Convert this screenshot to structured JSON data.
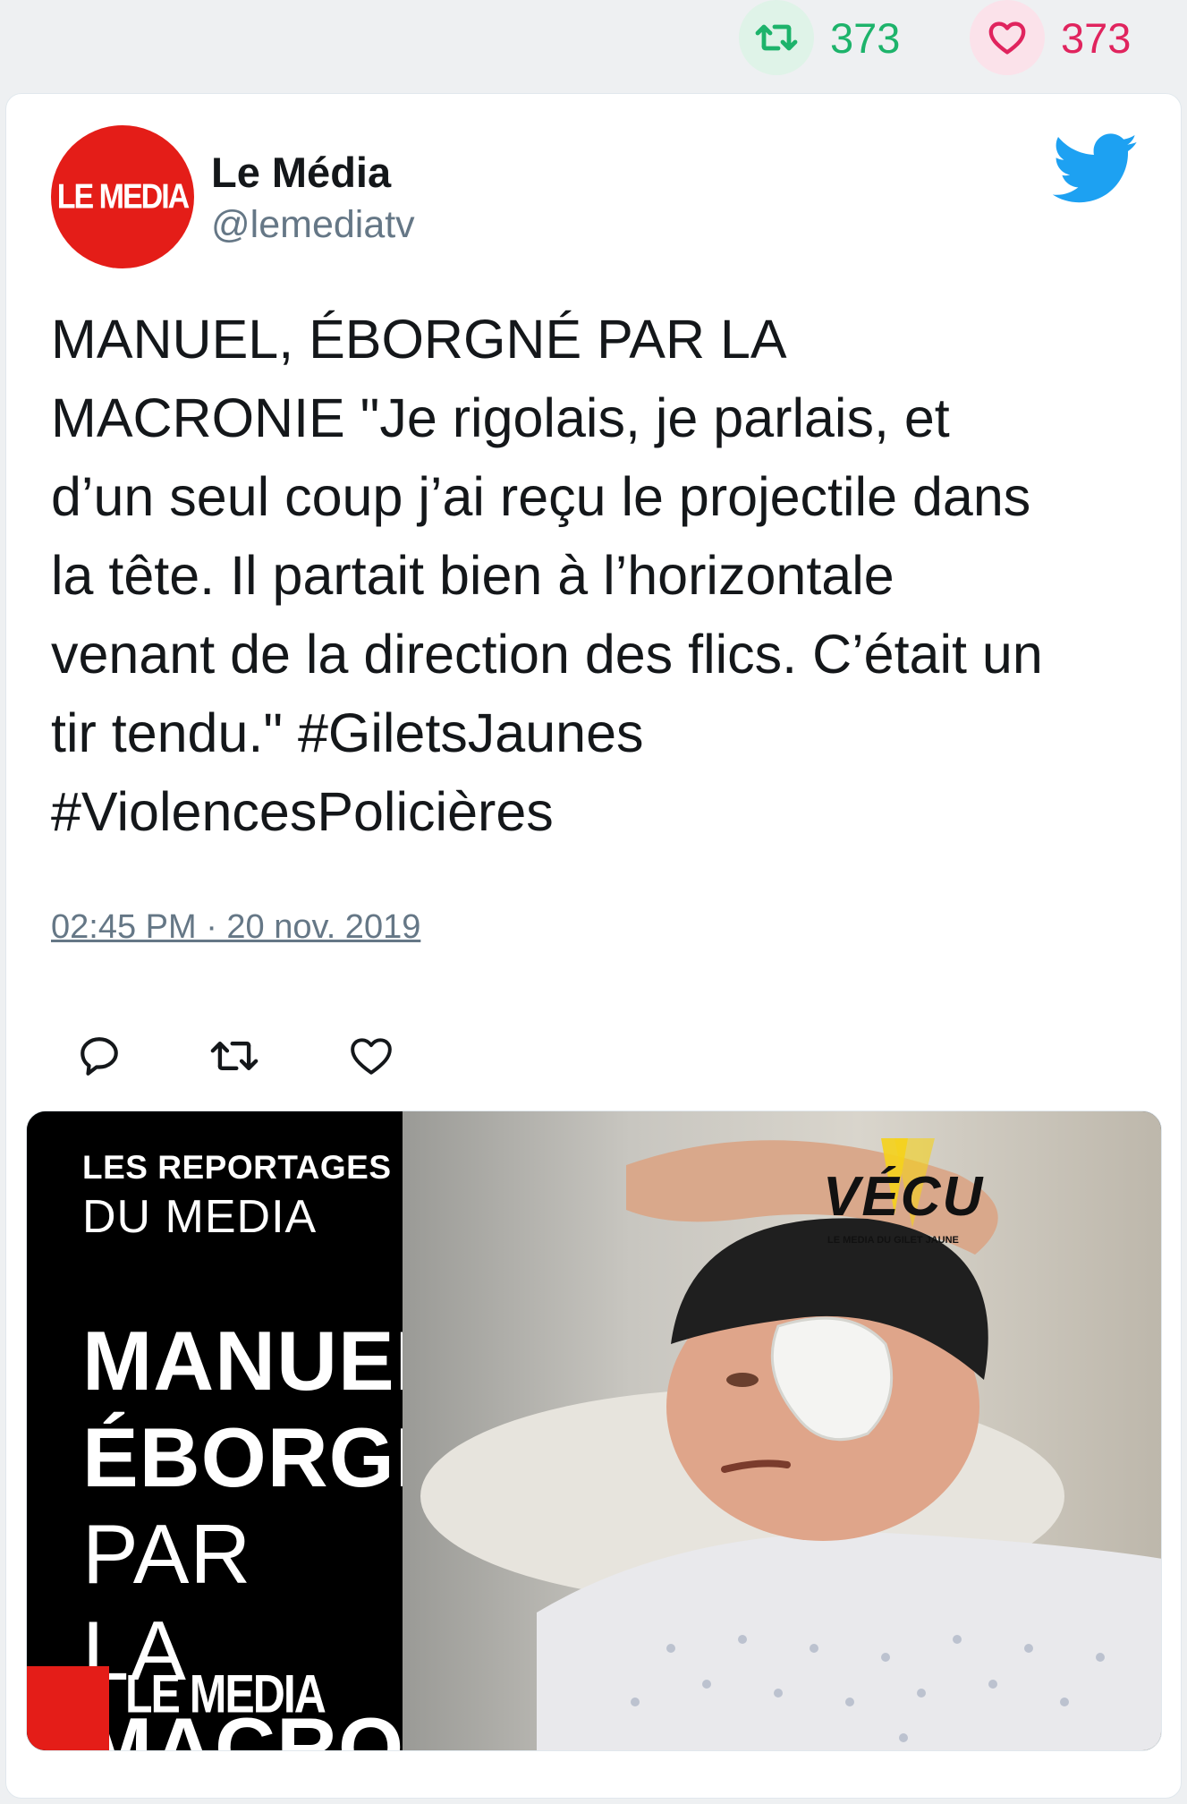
{
  "top_stats": {
    "retweet_count": "373",
    "like_count": "373"
  },
  "tweet": {
    "author_name": "Le Média",
    "author_handle": "@lemediatv",
    "avatar_logo_text": "LE MEDIA",
    "text": "MANUEL, ÉBORGNÉ PAR LA\nMACRONIE \"Je rigolais, je parlais, et\nd’un seul coup j’ai reçu le projectile dans\nla tête. Il partait bien à l’horizontale\nvenant de la direction des flics. C’était un\ntir tendu.\" #GiletsJaunes\n#ViolencesPolicières",
    "timestamp": "02:45 PM · 20 nov. 2019"
  },
  "media": {
    "series_line1": "LES REPORTAGES",
    "series_line2": "DU MEDIA",
    "headline_bold1": "MANUEL,",
    "headline_bold2": "ÉBORGNÉ",
    "headline_light2": " PAR",
    "headline_light3": "LA ",
    "headline_bold3": "MACRONIE",
    "bottom_logo": "LE MEDIA",
    "vecu_title": "VÉCU",
    "vecu_subtitle": "LE MEDIA DU GILET JAUNE"
  },
  "icons": {
    "retweet": "retweet-icon",
    "like": "heart-icon",
    "reply": "reply-icon",
    "brand": "twitter-bird-icon"
  },
  "colors": {
    "retweet_green": "#1db36b",
    "like_pink": "#e0245e",
    "twitter_blue": "#1da1f2",
    "brand_red": "#e41d18"
  }
}
